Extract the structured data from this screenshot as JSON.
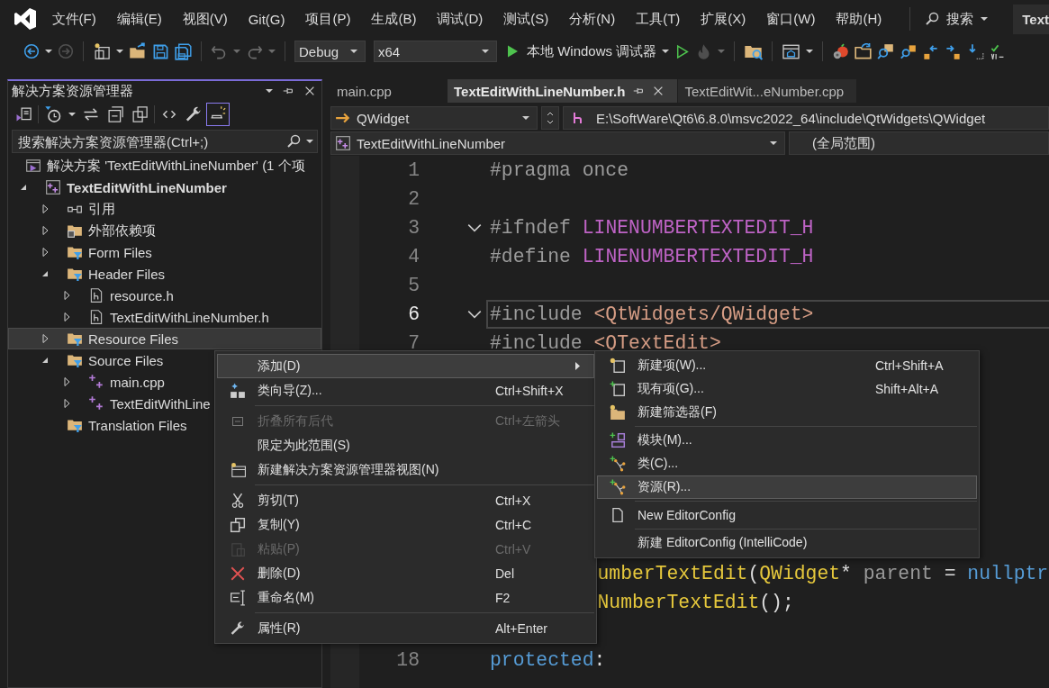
{
  "menubar": {
    "items": [
      "文件(F)",
      "编辑(E)",
      "视图(V)",
      "Git(G)",
      "项目(P)",
      "生成(B)",
      "调试(D)",
      "测试(S)",
      "分析(N)",
      "工具(T)",
      "扩展(X)",
      "窗口(W)",
      "帮助(H)"
    ],
    "search": "搜索",
    "title": "Text"
  },
  "toolbar": {
    "items": [
      {
        "kind": "back",
        "disabled": false,
        "dropdown": true
      },
      {
        "kind": "forward",
        "disabled": true
      },
      {
        "kind": "separator"
      },
      {
        "kind": "new-project",
        "dropdown": true
      },
      {
        "kind": "open"
      },
      {
        "kind": "save"
      },
      {
        "kind": "save-all"
      },
      {
        "kind": "separator"
      },
      {
        "kind": "undo",
        "disabled": true,
        "dropdown": true
      },
      {
        "kind": "redo",
        "disabled": true,
        "dropdown": true
      },
      {
        "kind": "separator"
      },
      {
        "kind": "combo",
        "value": "Debug"
      },
      {
        "kind": "combo",
        "value": "x64"
      },
      {
        "kind": "run",
        "label": "本地 Windows 调试器",
        "dropdown": true
      },
      {
        "kind": "run-outline",
        "disabled": false
      },
      {
        "kind": "flame",
        "disabled": true,
        "dropdown": true
      },
      {
        "kind": "separator"
      },
      {
        "kind": "folder-search"
      },
      {
        "kind": "separator"
      },
      {
        "kind": "window",
        "dropdown": true
      },
      {
        "kind": "separator"
      },
      {
        "kind": "gear-tomato"
      },
      {
        "kind": "folder-arrow"
      },
      {
        "kind": "find-files"
      },
      {
        "kind": "find-symbol"
      },
      {
        "kind": "bookmark-prev"
      },
      {
        "kind": "bookmark-next"
      },
      {
        "kind": "bookmark-down"
      },
      {
        "kind": "spellcheck"
      }
    ]
  },
  "explorer": {
    "title": "解决方案资源管理器",
    "tools": [
      {
        "kind": "switch-views",
        "active": false
      },
      {
        "kind": "separator"
      },
      {
        "kind": "history",
        "active": false,
        "dropdown": true
      },
      {
        "kind": "sync",
        "active": false
      },
      {
        "kind": "collapse",
        "active": false
      },
      {
        "kind": "copies",
        "active": false
      },
      {
        "kind": "separator"
      },
      {
        "kind": "code",
        "active": false
      },
      {
        "kind": "wrench",
        "active": false
      },
      {
        "kind": "preview",
        "active": true
      }
    ],
    "search": {
      "placeholder": "搜索解决方案资源管理器(Ctrl+;)"
    },
    "tree": [
      {
        "label": "解决方案 'TextEditWithLineNumber' (1 个项",
        "kind": "solution",
        "selected": false,
        "children": [
          {
            "label": "TextEditWithLineNumber",
            "kind": "project",
            "expanded": true,
            "selected": false,
            "children": [
              {
                "label": "引用",
                "kind": "references",
                "expanded": false,
                "selected": false
              },
              {
                "label": "外部依赖项",
                "kind": "external",
                "expanded": false,
                "selected": false
              },
              {
                "label": "Form Files",
                "kind": "filter",
                "expanded": false,
                "selected": false
              },
              {
                "label": "Header Files",
                "kind": "filter",
                "expanded": true,
                "selected": false,
                "children": [
                  {
                    "label": "resource.h",
                    "kind": "header",
                    "expanded": false,
                    "selected": false
                  },
                  {
                    "label": "TextEditWithLineNumber.h",
                    "kind": "header",
                    "expanded": false,
                    "selected": false
                  }
                ]
              },
              {
                "label": "Resource Files",
                "kind": "filter",
                "expanded": false,
                "selected": true
              },
              {
                "label": "Source Files",
                "kind": "filter",
                "expanded": true,
                "selected": false,
                "children": [
                  {
                    "label": "main.cpp",
                    "kind": "source",
                    "expanded": false,
                    "selected": false
                  },
                  {
                    "label": "TextEditWithLine",
                    "kind": "source",
                    "expanded": false,
                    "selected": false
                  }
                ]
              },
              {
                "label": "Translation Files",
                "kind": "filter",
                "selected": false
              }
            ]
          }
        ]
      }
    ]
  },
  "editor": {
    "tabs": [
      {
        "label": "main.cpp",
        "selected": false
      },
      {
        "label": "TextEditWithLineNumber.h",
        "selected": true
      },
      {
        "label": "TextEditWit...eNumber.cpp",
        "selected": false
      }
    ],
    "navigation": {
      "type": "QWidget",
      "path": "E:\\SoftWare\\Qt6\\6.8.0\\msvc2022_64\\include\\QtWidgets\\QWidget",
      "class": "TextEditWithLineNumber",
      "scope": "(全局范围)"
    },
    "code_top": [
      {
        "number": "1",
        "fold": false,
        "current": false,
        "segments": [
          {
            "text": "#pragma once",
            "kind": "directive"
          }
        ]
      },
      {
        "number": "2",
        "fold": false,
        "current": false
      },
      {
        "number": "3",
        "fold": true,
        "current": false,
        "segments": [
          {
            "text": "#ifndef ",
            "kind": "directive"
          },
          {
            "text": "LINENUMBERTEXTEDIT_H",
            "kind": "macro"
          }
        ]
      },
      {
        "number": "4",
        "fold": false,
        "current": false,
        "segments": [
          {
            "text": "#define ",
            "kind": "directive"
          },
          {
            "text": "LINENUMBERTEXTEDIT_H",
            "kind": "macro"
          }
        ]
      },
      {
        "number": "5",
        "fold": false,
        "current": false
      },
      {
        "number": "6",
        "fold": true,
        "current": true,
        "segments": [
          {
            "text": "#include ",
            "kind": "directive"
          },
          {
            "text": "<QtWidgets/QWidget>",
            "kind": "string"
          }
        ]
      },
      {
        "number": "7",
        "fold": false,
        "current": false,
        "segments": [
          {
            "text": "#include ",
            "kind": "directive"
          },
          {
            "text": "<QTextEdit>",
            "kind": "string"
          }
        ]
      }
    ],
    "code_bottom": [
      {
        "kind": "partial",
        "blank_before": false,
        "segments": [
          {
            "text": "umberTextEdit",
            "kind": "type"
          },
          {
            "text": "(",
            "kind": "plain"
          },
          {
            "text": "QWidget",
            "kind": "type"
          },
          {
            "text": "* ",
            "kind": "plain"
          },
          {
            "text": "parent",
            "kind": "param"
          },
          {
            "text": " = ",
            "kind": "plain"
          },
          {
            "text": "nullptr",
            "kind": "keyword"
          }
        ]
      },
      {
        "kind": "partial",
        "blank_before": false,
        "segments": [
          {
            "text": "NumberTextEdit",
            "kind": "type"
          },
          {
            "text": "();",
            "kind": "plain"
          }
        ]
      },
      {
        "number": "18",
        "blank_before": true,
        "segments": [
          {
            "text": "protected",
            "kind": "keyword"
          },
          {
            "text": ":",
            "kind": "plain"
          }
        ]
      }
    ]
  },
  "context_menu": {
    "items": [
      {
        "kind": "add",
        "label": "添加(D)",
        "selected": true,
        "disabled": false,
        "submenu": {
          "items": [
            {
              "kind": "new-item",
              "label": "新建项(W)...",
              "shortcut": "Ctrl+Shift+A",
              "selected": false,
              "disabled": false
            },
            {
              "kind": "existing-item",
              "label": "现有项(G)...",
              "shortcut": "Shift+Alt+A",
              "selected": false,
              "disabled": false
            },
            {
              "kind": "new-filter",
              "label": "新建筛选器(F)",
              "selected": false,
              "disabled": false
            },
            {
              "kind": "separator"
            },
            {
              "kind": "module",
              "label": "模块(M)...",
              "selected": false,
              "disabled": false
            },
            {
              "kind": "class",
              "label": "类(C)...",
              "selected": false,
              "disabled": false
            },
            {
              "kind": "resource",
              "label": "资源(R)...",
              "selected": true,
              "disabled": false
            },
            {
              "kind": "separator"
            },
            {
              "kind": "editorconfig",
              "label": "New EditorConfig",
              "selected": false,
              "disabled": false
            },
            {
              "kind": "separator"
            },
            {
              "kind": "intellicode",
              "label": "新建 EditorConfig (IntelliCode)",
              "selected": false,
              "disabled": false
            }
          ]
        }
      },
      {
        "kind": "wizard",
        "label": "类向导(Z)...",
        "shortcut": "Ctrl+Shift+X",
        "selected": false,
        "disabled": false
      },
      {
        "kind": "separator"
      },
      {
        "kind": "collapse",
        "label": "折叠所有后代",
        "shortcut": "Ctrl+左箭头",
        "selected": false,
        "disabled": true
      },
      {
        "kind": "scope",
        "label": "限定为此范围(S)",
        "selected": false,
        "disabled": false
      },
      {
        "kind": "new-view",
        "label": "新建解决方案资源管理器视图(N)",
        "selected": false,
        "disabled": false
      },
      {
        "kind": "separator"
      },
      {
        "kind": "cut",
        "label": "剪切(T)",
        "shortcut": "Ctrl+X",
        "selected": false,
        "disabled": false
      },
      {
        "kind": "copy",
        "label": "复制(Y)",
        "shortcut": "Ctrl+C",
        "selected": false,
        "disabled": false
      },
      {
        "kind": "paste",
        "label": "粘贴(P)",
        "shortcut": "Ctrl+V",
        "selected": false,
        "disabled": true
      },
      {
        "kind": "delete",
        "label": "删除(D)",
        "shortcut": "Del",
        "selected": false,
        "disabled": false
      },
      {
        "kind": "rename",
        "label": "重命名(M)",
        "shortcut": "F2",
        "selected": false,
        "disabled": false
      },
      {
        "kind": "separator"
      },
      {
        "kind": "properties",
        "label": "属性(R)",
        "shortcut": "Alt+Enter",
        "selected": false,
        "disabled": false
      }
    ]
  }
}
